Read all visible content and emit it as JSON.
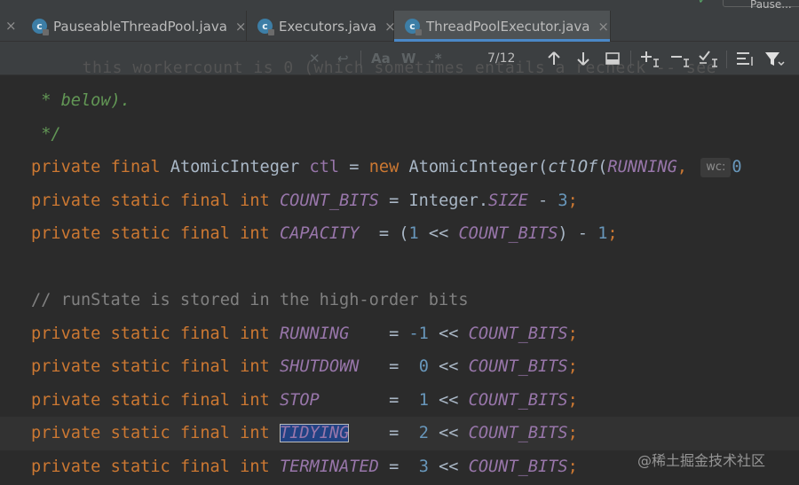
{
  "tabs": [
    {
      "label": "PauseableThreadPool.java",
      "icon": "java-class-icon",
      "active": false
    },
    {
      "label": "Executors.java",
      "icon": "java-class-icon",
      "active": false
    },
    {
      "label": "ThreadPoolExecutor.java",
      "icon": "java-class-icon",
      "active": true
    }
  ],
  "tab_icon_letter": "c",
  "close_glyph": "×",
  "run_config_label": "Pause...",
  "search": {
    "ghost_text": "  this workercount is 0 (which sometimes entails a recheck -- see",
    "match_counter": "7/12",
    "options": {
      "match_case": "Aa",
      "words": "W",
      "regex": ".*"
    },
    "icons": [
      "clear-icon",
      "history-icon",
      "prev-occurrence-icon",
      "next-occurrence-icon",
      "select-all-occurrences-icon",
      "add-selection-icon",
      "remove-selection-icon",
      "select-all-icon",
      "multiline-icon",
      "filter-icon"
    ]
  },
  "code": {
    "doc_1": " * below).",
    "doc_2": " */",
    "l_ctl": [
      "private",
      "final",
      "AtomicInteger",
      "ctl",
      "=",
      "new",
      "AtomicInteger(",
      "ctlOf",
      "(",
      "RUNNING",
      ",",
      "wc:",
      "0"
    ],
    "l_count_bits": [
      "private",
      "static",
      "final",
      "int",
      "COUNT_BITS",
      "= Integer.",
      "SIZE",
      " - ",
      "3",
      ";"
    ],
    "l_capacity": [
      "private",
      "static",
      "final",
      "int",
      "CAPACITY",
      "  = (",
      "1",
      " << ",
      "COUNT_BITS",
      ") - ",
      "1",
      ";"
    ],
    "comment": "// runState is stored in the high-order bits",
    "states": [
      {
        "name": "RUNNING",
        "pad": "    ",
        "eq": "= ",
        "val": "-1",
        "shift": " << ",
        "ref": "COUNT_BITS",
        "end": ";"
      },
      {
        "name": "SHUTDOWN",
        "pad": "   ",
        "eq": "=  ",
        "val": "0",
        "shift": " << ",
        "ref": "COUNT_BITS",
        "end": ";"
      },
      {
        "name": "STOP",
        "pad": "       ",
        "eq": "=  ",
        "val": "1",
        "shift": " << ",
        "ref": "COUNT_BITS",
        "end": ";"
      },
      {
        "name": "TIDYING",
        "pad": "    ",
        "eq": "=  ",
        "val": "2",
        "shift": " << ",
        "ref": "COUNT_BITS",
        "end": ";"
      },
      {
        "name": "TERMINATED",
        "pad": " ",
        "eq": "=  ",
        "val": "3",
        "shift": " << ",
        "ref": "COUNT_BITS",
        "end": ";"
      }
    ],
    "modifiers": [
      "private",
      "static",
      "final",
      "int"
    ]
  },
  "watermark": "@稀土掘金技术社区",
  "colors": {
    "keyword": "#cc7832",
    "constant": "#9876aa",
    "number": "#6897bb",
    "doc_comment": "#629755",
    "comment": "#808080",
    "selection": "#214283",
    "active_tab_underline": "#4a88c7"
  }
}
